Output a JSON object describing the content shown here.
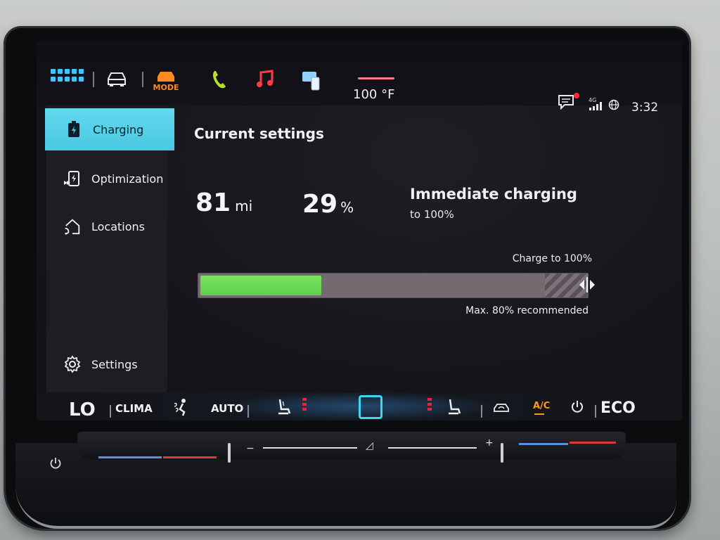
{
  "topbar": {
    "mode_label": "MODE",
    "temperature": "100 °F",
    "network": "4G",
    "time": "3:32"
  },
  "sidebar": {
    "items": [
      {
        "label": "Charging",
        "icon": "battery-icon",
        "active": true
      },
      {
        "label": "Optimization",
        "icon": "charge-optimization-icon",
        "active": false
      },
      {
        "label": "Locations",
        "icon": "home-location-icon",
        "active": false
      },
      {
        "label": "Settings",
        "icon": "gear-icon",
        "active": false
      }
    ]
  },
  "main": {
    "title": "Current settings",
    "range_value": "81",
    "range_unit": "mi",
    "battery_value": "29",
    "battery_unit": "%",
    "mode_title": "Immediate charging",
    "mode_subtitle": "to 100%",
    "charge_target_label": "Charge to 100%",
    "recommendation": "Max. 80% recommended",
    "current_charge_fraction": 0.29,
    "target_charge_fraction": 1.0,
    "recommended_max_fraction": 0.8
  },
  "climate": {
    "temperature_left": "LO",
    "clima_label": "CLIMA",
    "auto_label": "AUTO",
    "ac_label": "A/C",
    "eco_label": "ECO"
  },
  "colors": {
    "accent": "#4ac8e2",
    "charge_green": "#5fd04a",
    "mode_orange": "#ff8a1d",
    "heat_red": "#e3262f"
  }
}
